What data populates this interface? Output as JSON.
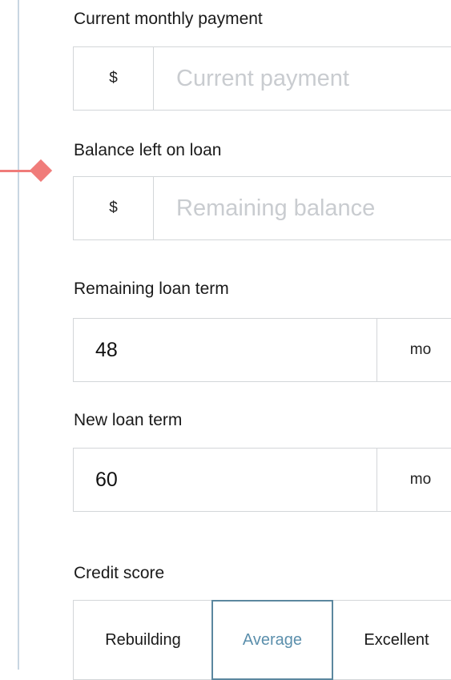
{
  "current_payment": {
    "label": "Current monthly payment",
    "prefix": "$",
    "placeholder": "Current payment",
    "value": ""
  },
  "balance": {
    "label": "Balance left on loan",
    "prefix": "$",
    "placeholder": "Remaining balance",
    "value": ""
  },
  "remaining_term": {
    "label": "Remaining loan term",
    "value": "48",
    "suffix": "mo"
  },
  "new_term": {
    "label": "New loan term",
    "value": "60",
    "suffix": "mo"
  },
  "credit_score": {
    "label": "Credit score",
    "options": [
      "Rebuilding",
      "Average",
      "Excellent"
    ],
    "selected": "Average",
    "selected_color": "#5b8fac"
  },
  "colors": {
    "marker": "#f07c7a",
    "rail": "#c8d6e2"
  },
  "icons": {
    "marker": "diamond-marker-icon"
  }
}
